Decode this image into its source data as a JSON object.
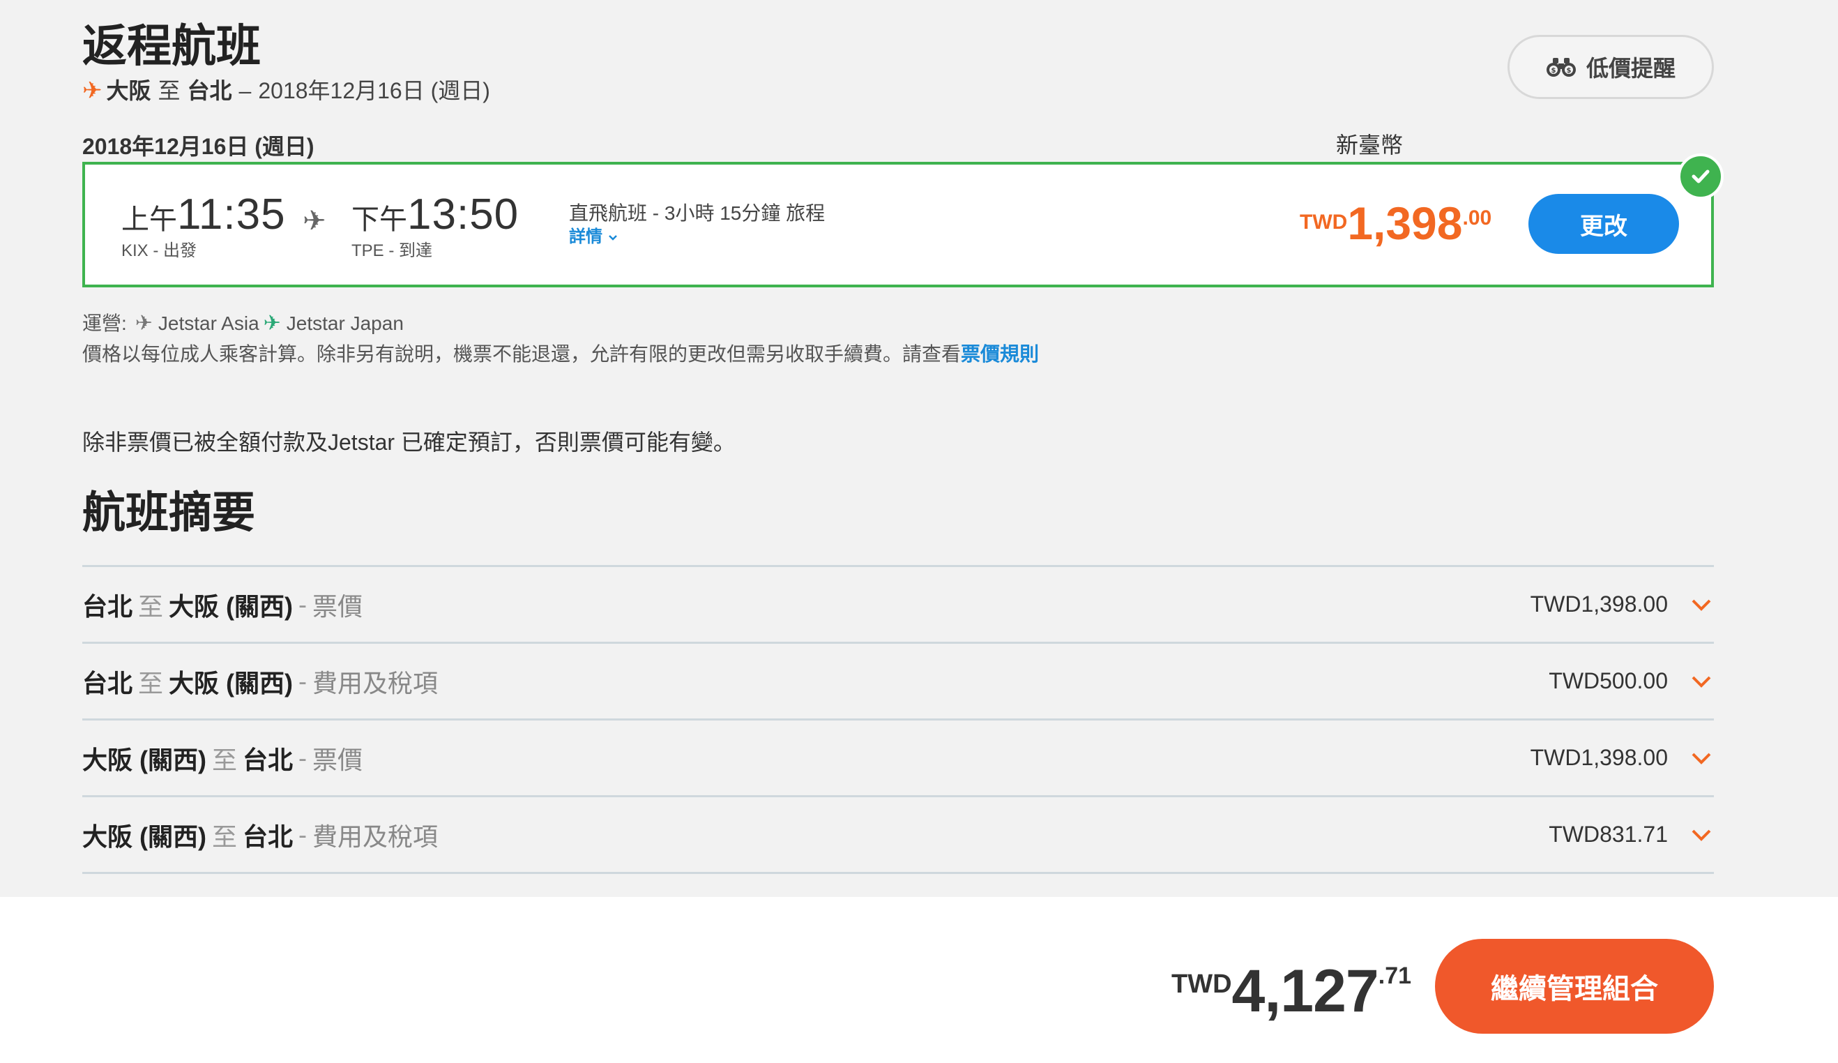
{
  "header": {
    "title": "返程航班",
    "route": {
      "origin": "大阪",
      "to_word": "至",
      "destination": "台北",
      "dash": "–",
      "date": "2018年12月16日 (週日)"
    },
    "low_price_alert_label": "低價提醒"
  },
  "flight": {
    "date_label": "2018年12月16日 (週日)",
    "currency_label": "新臺幣",
    "depart": {
      "ampm": "上午",
      "time": "11:35",
      "airport": "KIX - 出發"
    },
    "arrive": {
      "ampm": "下午",
      "time": "13:50",
      "airport": "TPE - 到達"
    },
    "description": "直飛航班 - 3小時 15分鐘 旅程",
    "details_label": "詳情",
    "price": {
      "currency": "TWD",
      "amount": "1,398",
      "decimals": ".00"
    },
    "change_label": "更改"
  },
  "operators": {
    "label": "運營:",
    "carrier_1": "Jetstar Asia",
    "carrier_2": "Jetstar Japan"
  },
  "fare_note": {
    "text": "價格以每位成人乘客計算。除非另有說明，機票不能退還，允許有限的更改但需另收取手續費。請查看",
    "link": "票價規則"
  },
  "price_disclaimer": "除非票價已被全額付款及Jetstar 已確定預訂，否則票價可能有變。",
  "summary": {
    "title": "航班摘要",
    "rows": [
      {
        "from": "台北",
        "to_word": "至",
        "to": "大阪 (關西)",
        "dash": "-",
        "kind": "票價",
        "amount": "TWD1,398.00"
      },
      {
        "from": "台北",
        "to_word": "至",
        "to": "大阪 (關西)",
        "dash": "-",
        "kind": "費用及稅項",
        "amount": "TWD500.00"
      },
      {
        "from": "大阪 (關西)",
        "to_word": "至",
        "to": "台北",
        "dash": "-",
        "kind": "票價",
        "amount": "TWD1,398.00"
      },
      {
        "from": "大阪 (關西)",
        "to_word": "至",
        "to": "台北",
        "dash": "-",
        "kind": "費用及稅項",
        "amount": "TWD831.71"
      }
    ]
  },
  "footer": {
    "total": {
      "currency": "TWD",
      "amount": "4,127",
      "decimals": ".71"
    },
    "continue_label": "繼續管理組合"
  },
  "colors": {
    "brand_orange": "#f26822",
    "accent_blue": "#1a8ae8",
    "selected_green": "#3fb34f",
    "cta_orange": "#f0582b"
  },
  "icons": {
    "route_plane": "plane-icon",
    "alert": "binoculars-icon",
    "check": "check-icon",
    "card_plane": "plane-icon",
    "details_chevron": "chevron-down-icon",
    "row_chevron": "chevron-down-icon"
  }
}
